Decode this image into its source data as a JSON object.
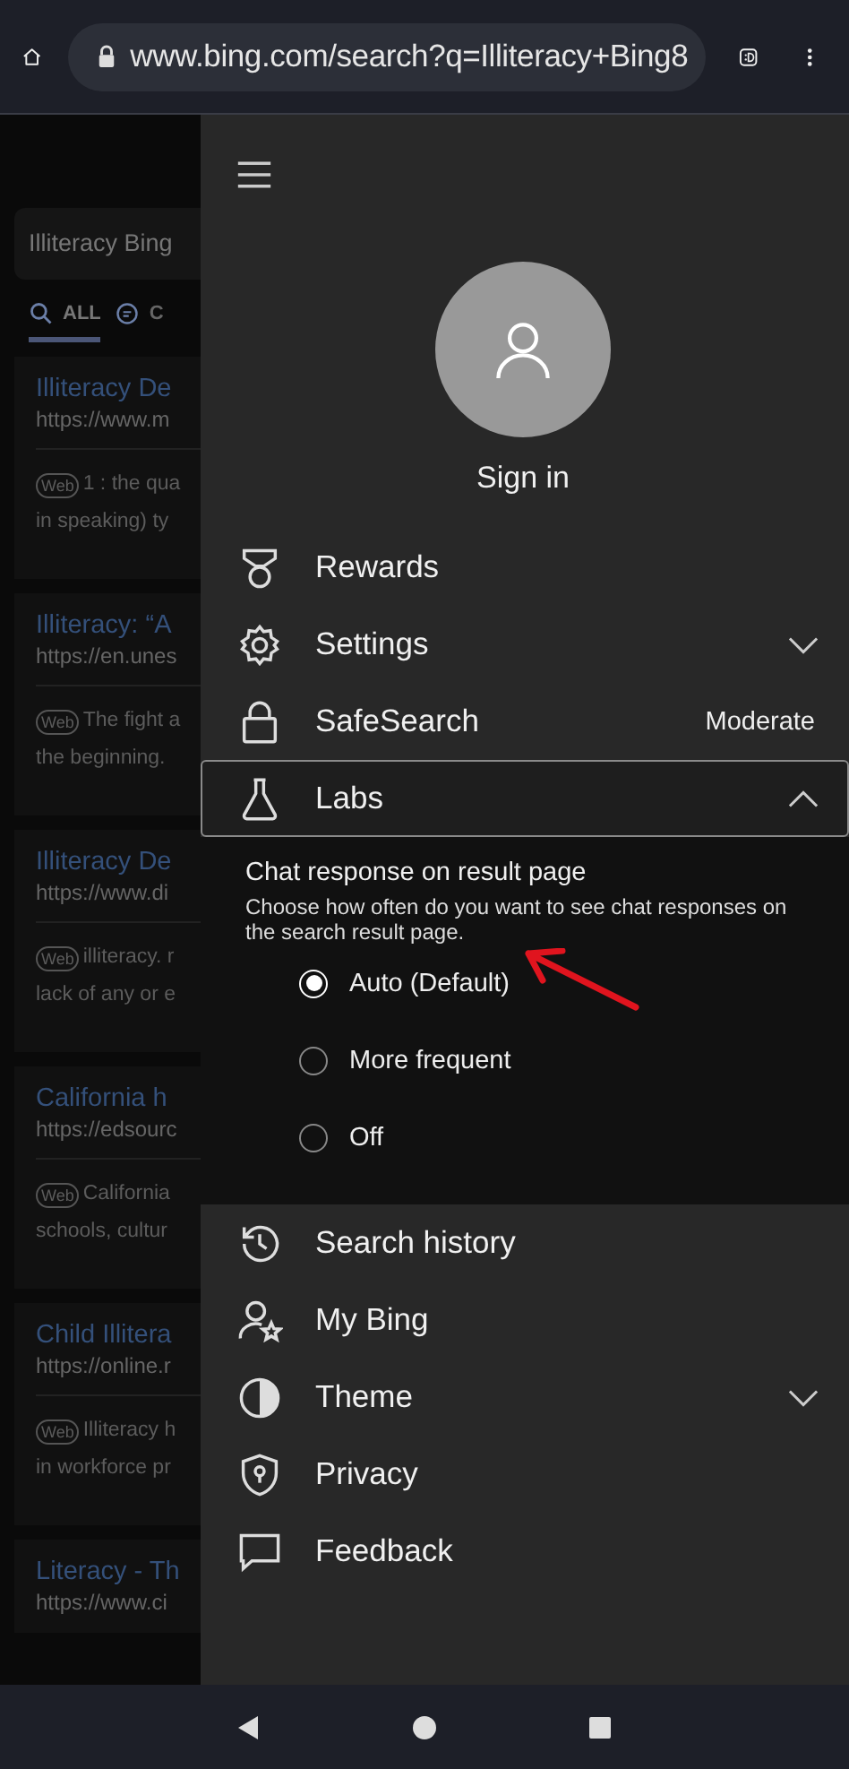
{
  "browser": {
    "url": "www.bing.com/search?q=Illiteracy+Bing8"
  },
  "page": {
    "search_query": "Illiteracy Bing",
    "tabs": [
      {
        "label": "ALL",
        "selected": true
      },
      {
        "label": "C",
        "selected": false
      }
    ],
    "results": [
      {
        "title": "Illiteracy De",
        "url": "https://www.m",
        "badge": "Web",
        "snippet": [
          "1 : the qua",
          "in speaking) ty"
        ]
      },
      {
        "title": "Illiteracy: “A",
        "url": "https://en.unes",
        "badge": "Web",
        "snippet": [
          "The fight a",
          "the beginning."
        ]
      },
      {
        "title": "Illiteracy De",
        "url": "https://www.di",
        "badge": "Web",
        "snippet": [
          "illiteracy. r",
          "lack of any or e"
        ]
      },
      {
        "title": "California h",
        "url": "https://edsourc",
        "badge": "Web",
        "snippet": [
          "California",
          "schools, cultur"
        ]
      },
      {
        "title": "Child Illitera",
        "url": "https://online.r",
        "badge": "Web",
        "snippet": [
          "Illiteracy h",
          "in workforce pr"
        ]
      },
      {
        "title": "Literacy - Th",
        "url": "https://www.ci"
      }
    ]
  },
  "drawer": {
    "sign_in": "Sign in",
    "items": [
      {
        "label": "Rewards"
      },
      {
        "label": "Settings",
        "expanded": false
      },
      {
        "label": "SafeSearch",
        "value": "Moderate"
      },
      {
        "label": "Labs",
        "expanded": true,
        "selected": true
      },
      {
        "label": "Search history"
      },
      {
        "label": "My Bing"
      },
      {
        "label": "Theme",
        "expanded": false
      },
      {
        "label": "Privacy"
      },
      {
        "label": "Feedback"
      }
    ],
    "labs_panel": {
      "heading": "Chat response on result page",
      "description": "Choose how often do you want to see chat responses on the search result page.",
      "options": [
        {
          "label": "Auto (Default)",
          "selected": true
        },
        {
          "label": "More frequent",
          "selected": false
        },
        {
          "label": "Off",
          "selected": false
        }
      ]
    }
  }
}
